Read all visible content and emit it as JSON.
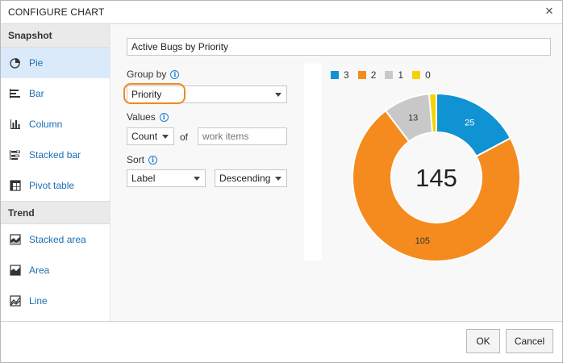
{
  "dialog": {
    "title": "CONFIGURE CHART",
    "close_icon": "close-icon"
  },
  "sidebar": {
    "snapshot_header": "Snapshot",
    "trend_header": "Trend",
    "snapshot_items": [
      {
        "label": "Pie",
        "icon": "pie-chart-icon",
        "selected": true
      },
      {
        "label": "Bar",
        "icon": "bar-chart-icon",
        "selected": false
      },
      {
        "label": "Column",
        "icon": "column-chart-icon",
        "selected": false
      },
      {
        "label": "Stacked bar",
        "icon": "stacked-bar-icon",
        "selected": false
      },
      {
        "label": "Pivot table",
        "icon": "pivot-table-icon",
        "selected": false
      }
    ],
    "trend_items": [
      {
        "label": "Stacked area",
        "icon": "stacked-area-icon"
      },
      {
        "label": "Area",
        "icon": "area-chart-icon"
      },
      {
        "label": "Line",
        "icon": "line-chart-icon"
      }
    ]
  },
  "form": {
    "chart_title": "Active Bugs by Priority",
    "group_by_label": "Group by",
    "group_by_value": "Priority",
    "values_label": "Values",
    "values_agg": "Count",
    "of_label": "of",
    "work_items_placeholder": "work items",
    "sort_label": "Sort",
    "sort_by": "Label",
    "sort_order": "Descending"
  },
  "colors": {
    "accent": "#1a6fb5",
    "highlight": "#f08a24",
    "selected_bg": "#dbeafa"
  },
  "chart_data": {
    "type": "pie",
    "style": "donut",
    "total": 145,
    "legend_position": "top",
    "categories": [
      "3",
      "2",
      "1",
      "0"
    ],
    "values": [
      25,
      105,
      13,
      2
    ],
    "data_labels": [
      "25",
      "105",
      "13",
      ""
    ],
    "colors": [
      "#0f93d2",
      "#f58b1f",
      "#c8c8c8",
      "#f5d200"
    ],
    "center_label": "145"
  },
  "footer": {
    "ok_label": "OK",
    "cancel_label": "Cancel"
  }
}
